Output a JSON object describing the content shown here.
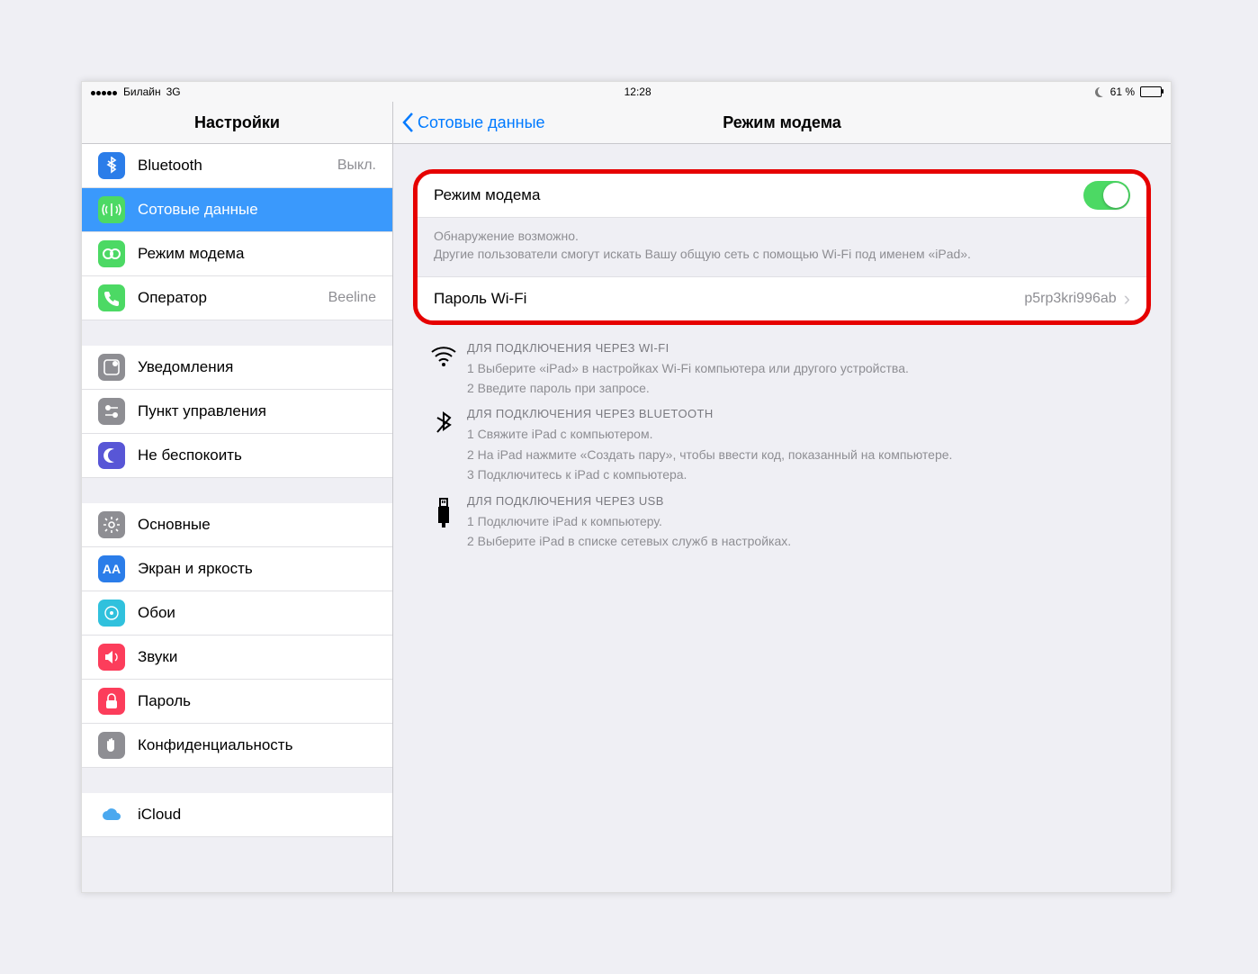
{
  "status": {
    "carrier": "Билайн",
    "network": "3G",
    "time": "12:28",
    "battery_pct": "61 %"
  },
  "sidebar": {
    "title": "Настройки",
    "items": [
      {
        "label": "Bluetooth",
        "value": "Выкл."
      },
      {
        "label": "Сотовые данные",
        "value": ""
      },
      {
        "label": "Режим модема",
        "value": ""
      },
      {
        "label": "Оператор",
        "value": "Beeline"
      },
      {
        "label": "Уведомления",
        "value": ""
      },
      {
        "label": "Пункт управления",
        "value": ""
      },
      {
        "label": "Не беспокоить",
        "value": ""
      },
      {
        "label": "Основные",
        "value": ""
      },
      {
        "label": "Экран и яркость",
        "value": ""
      },
      {
        "label": "Обои",
        "value": ""
      },
      {
        "label": "Звуки",
        "value": ""
      },
      {
        "label": "Пароль",
        "value": ""
      },
      {
        "label": "Конфиденциальность",
        "value": ""
      },
      {
        "label": "iCloud",
        "value": ""
      }
    ]
  },
  "content": {
    "back": "Сотовые данные",
    "title": "Режим модема",
    "hotspot_row": "Режим модема",
    "note1": "Обнаружение возможно.",
    "note2": "Другие пользователи смогут искать Вашу общую сеть с помощью Wi-Fi под именем «iPad».",
    "pwd_label": "Пароль Wi-Fi",
    "pwd_value": "p5rp3kri996ab",
    "wifi": {
      "title": "ДЛЯ ПОДКЛЮЧЕНИЯ ЧЕРЕЗ WI-FI",
      "l1": "1 Выберите «iPad» в настройках Wi-Fi компьютера или другого устройства.",
      "l2": "2 Введите пароль при запросе."
    },
    "bt": {
      "title": "ДЛЯ ПОДКЛЮЧЕНИЯ ЧЕРЕЗ BLUETOOTH",
      "l1": "1 Свяжите iPad с компьютером.",
      "l2": "2 На iPad нажмите «Создать пару», чтобы ввести код, показанный на компьютере.",
      "l3": "3 Подключитесь к iPad с компьютера."
    },
    "usb": {
      "title": "ДЛЯ ПОДКЛЮЧЕНИЯ ЧЕРЕЗ USB",
      "l1": "1 Подключите iPad к компьютеру.",
      "l2": "2 Выберите iPad в списке сетевых служб в настройках."
    }
  }
}
